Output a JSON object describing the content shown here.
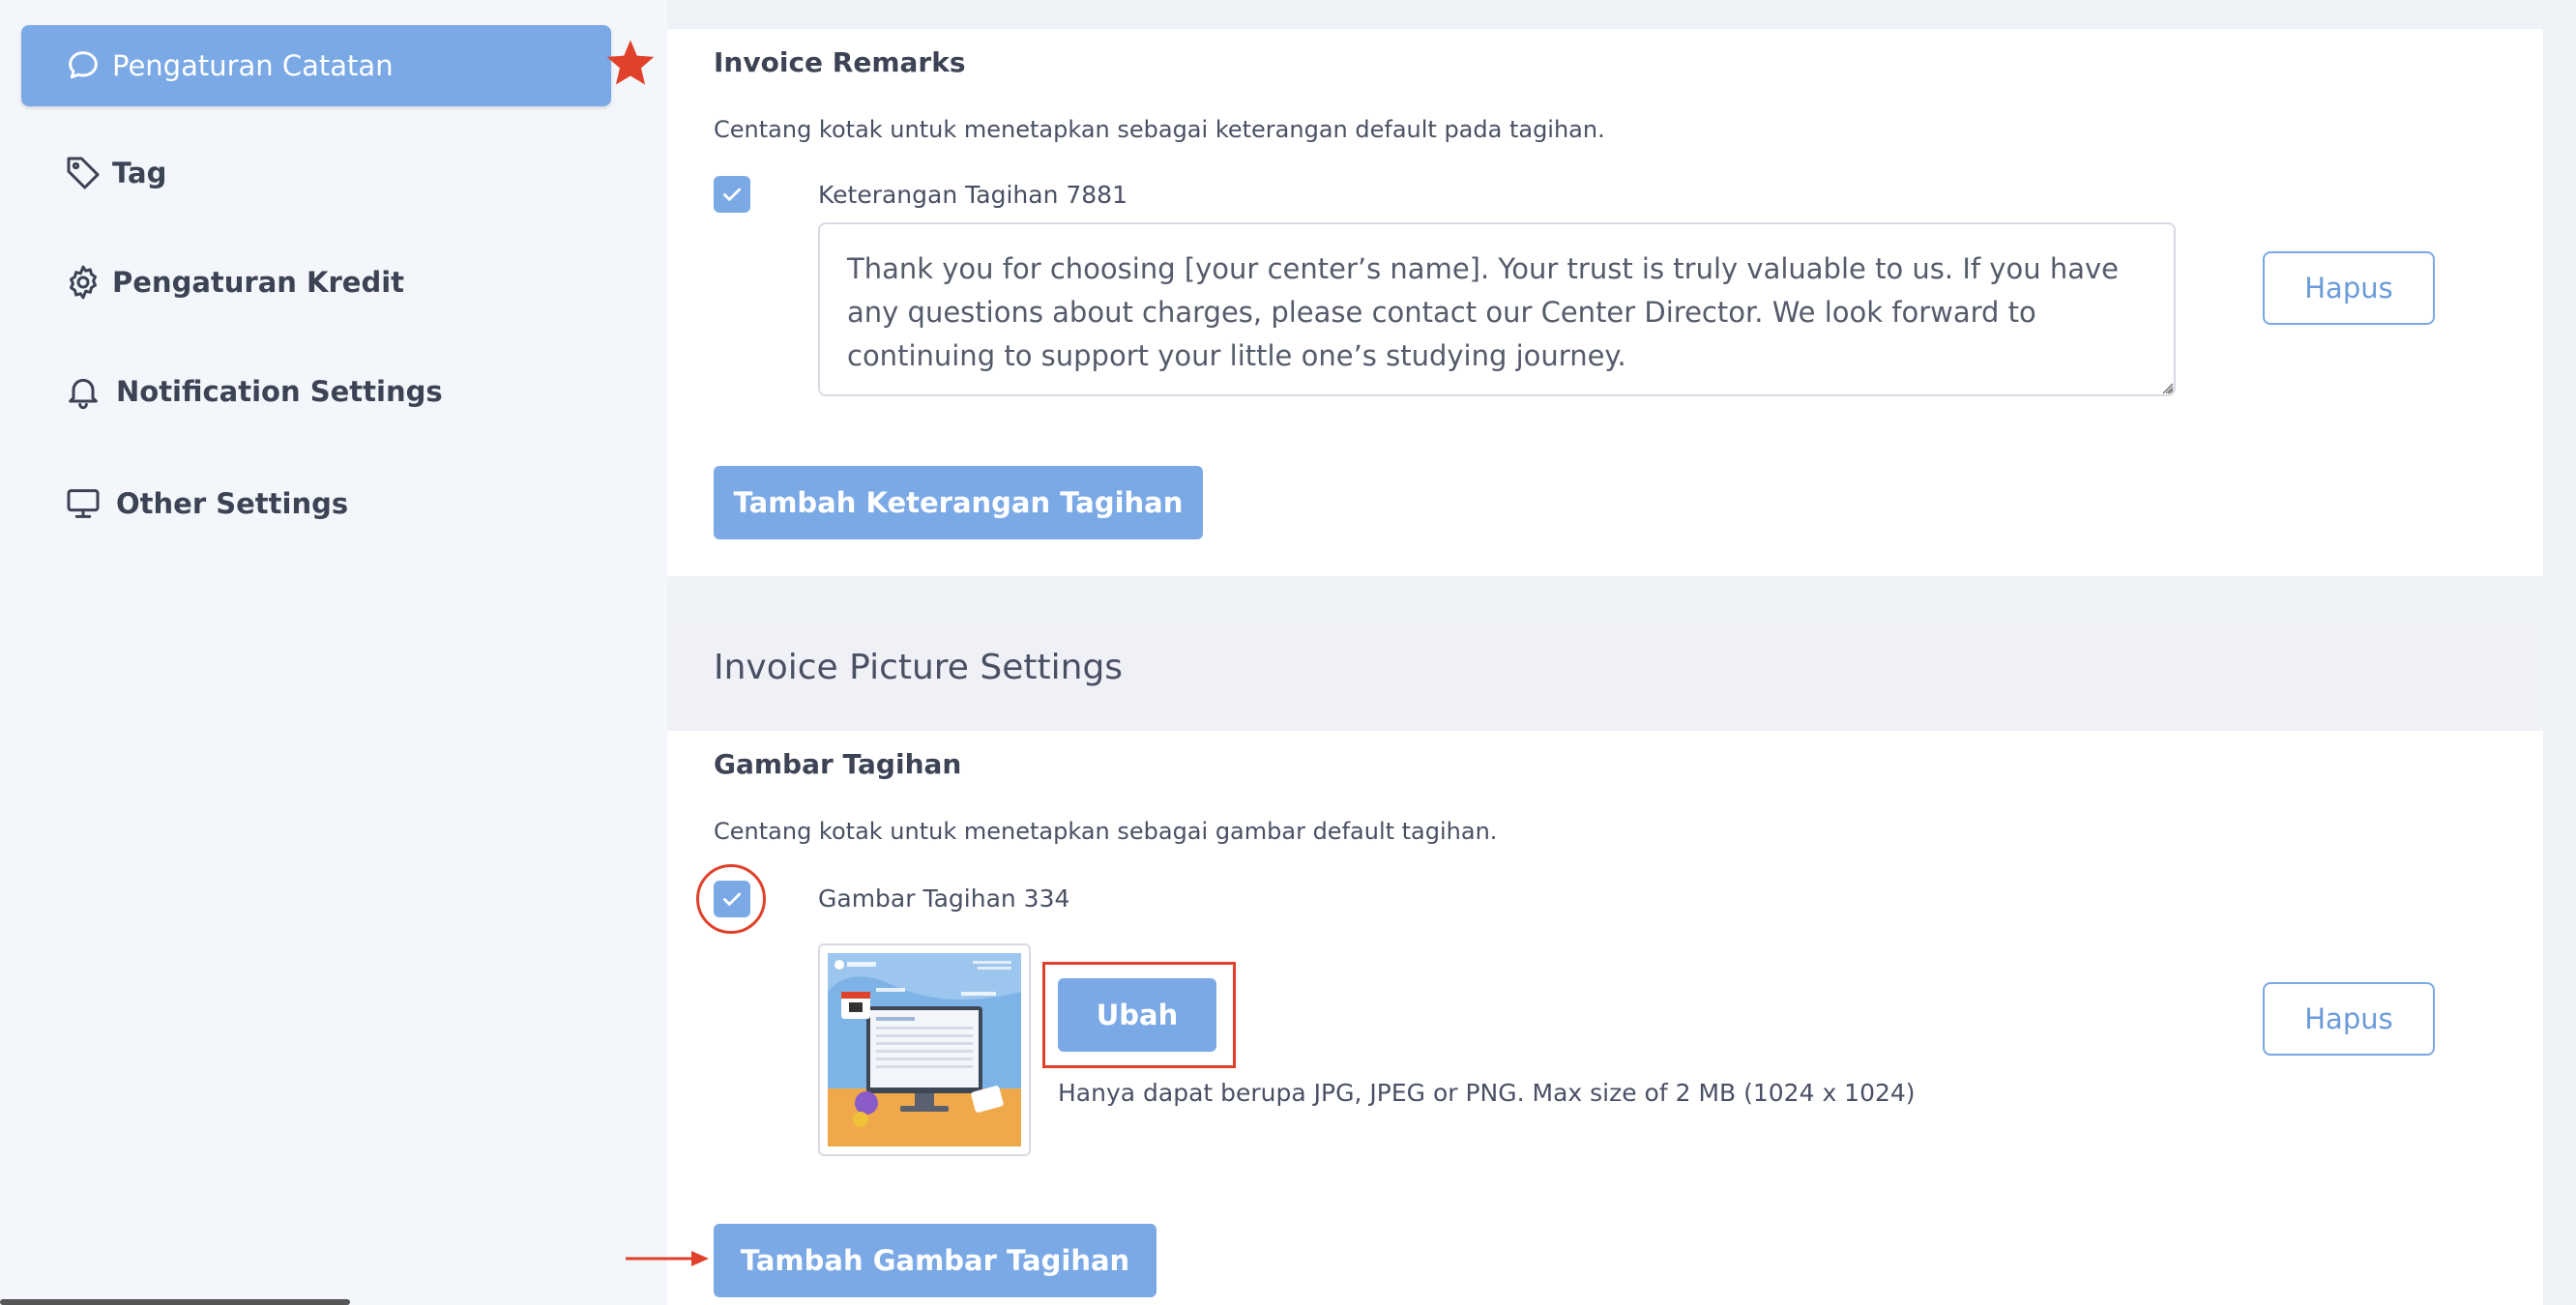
{
  "sidebar": {
    "items": [
      {
        "label": "Pengaturan Catatan",
        "icon": "chat-bubble-icon",
        "active": true
      },
      {
        "label": "Tag",
        "icon": "tag-icon",
        "active": false
      },
      {
        "label": "Pengaturan Kredit",
        "icon": "gear-icon",
        "active": false
      },
      {
        "label": "Notification Settings",
        "icon": "bell-icon",
        "active": false
      },
      {
        "label": "Other Settings",
        "icon": "monitor-icon",
        "active": false
      }
    ]
  },
  "remarks": {
    "title": "Invoice Remarks",
    "hint": "Centang kotak untuk menetapkan sebagai keterangan default pada tagihan.",
    "item_label": "Keterangan Tagihan 7881",
    "item_checked": true,
    "text": "Thank you for choosing [your center’s name]. Your trust is truly valuable to us. If you have any questions about charges, please contact our Center Director. We look forward to continuing to support your little one’s studying journey.",
    "delete_label": "Hapus",
    "add_label": "Tambah Keterangan Tagihan"
  },
  "picture": {
    "section_title": "Invoice Picture Settings",
    "title": "Gambar Tagihan",
    "hint": "Centang kotak untuk menetapkan sebagai gambar default tagihan.",
    "item_label": "Gambar Tagihan 334",
    "item_checked": true,
    "change_label": "Ubah",
    "file_hint": "Hanya dapat berupa JPG, JPEG or PNG. Max size of 2 MB (1024 x 1024)",
    "delete_label": "Hapus",
    "add_label": "Tambah Gambar Tagihan"
  },
  "colors": {
    "accent": "#7aa9e6",
    "annotation": "#e0412b"
  }
}
